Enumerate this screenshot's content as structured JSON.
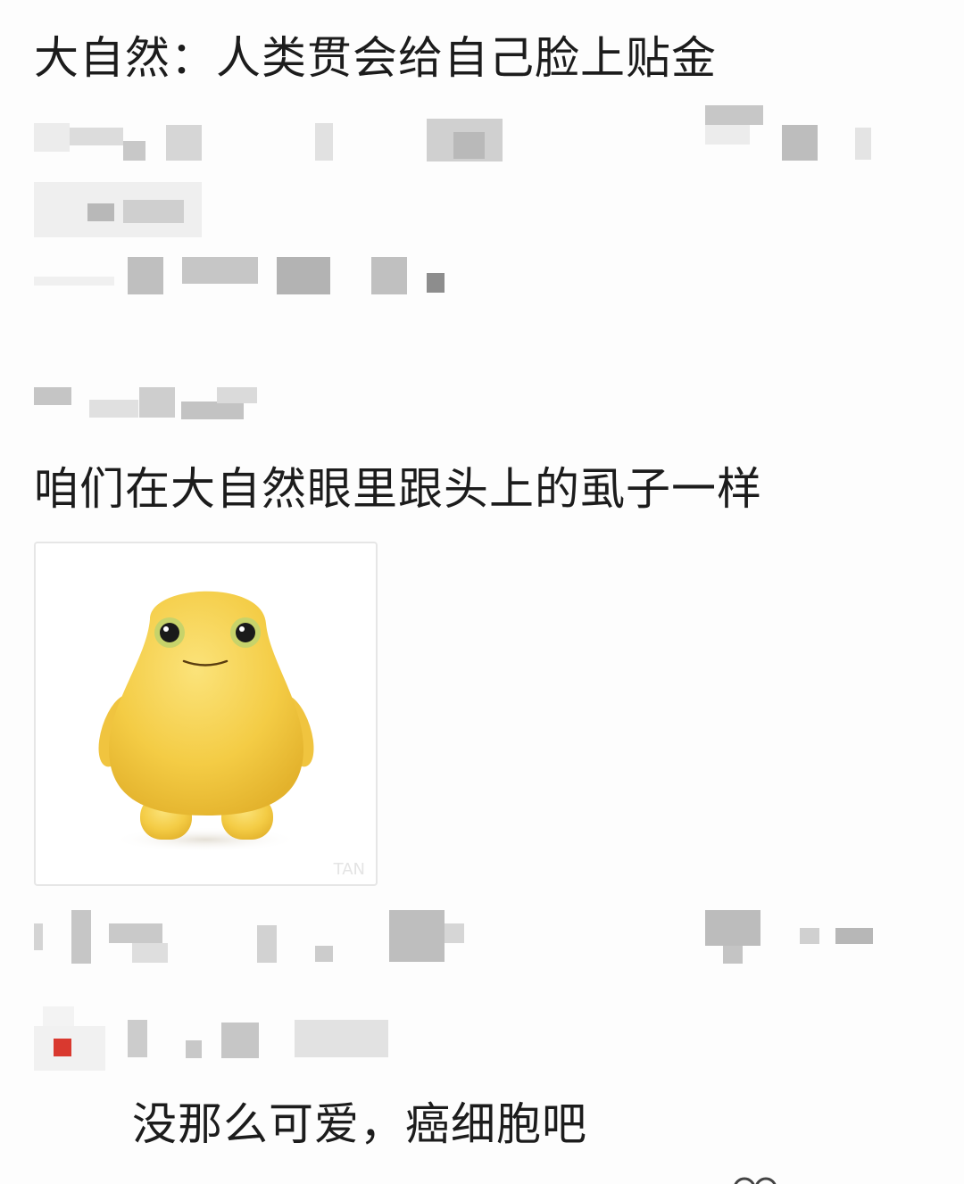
{
  "post": {
    "line1": "大自然：人类贯会给自己脸上贴金"
  },
  "reply": {
    "text": "咱们在大自然眼里跟头上的虱子一样",
    "image": {
      "subject": "yellow-blob-character",
      "watermark": "TAN"
    }
  },
  "sub_reply": {
    "text": "没那么可爱，癌细胞吧"
  },
  "colors": {
    "text": "#1c1c1c",
    "background": "#fdfdfd",
    "character_body": "#f6d04a",
    "badge_red": "#d9392f"
  }
}
